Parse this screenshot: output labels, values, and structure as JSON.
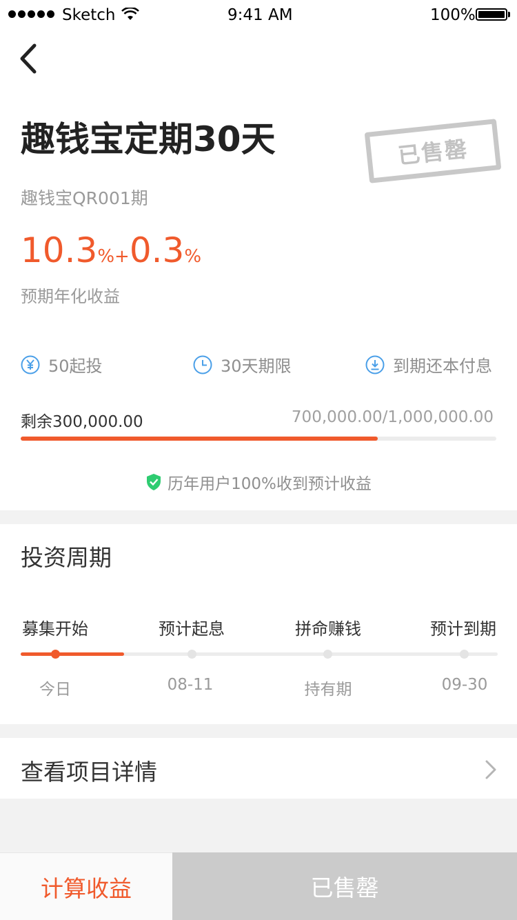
{
  "status_bar": {
    "carrier": "Sketch",
    "time": "9:41 AM",
    "battery": "100%"
  },
  "product": {
    "title": "趣钱宝定期30天",
    "subtitle": "趣钱宝QR001期",
    "stamp": "已售罄",
    "rate": {
      "base": "10.3",
      "base_unit": "%",
      "plus": "+",
      "bonus": "0.3",
      "bonus_unit": "%"
    },
    "rate_label": "预期年化收益"
  },
  "features": [
    {
      "icon": "yen-icon",
      "label": "50起投"
    },
    {
      "icon": "clock-icon",
      "label": "30天期限"
    },
    {
      "icon": "download-icon",
      "label": "到期还本付息"
    }
  ],
  "progress": {
    "remaining_label": "剩余300,000.00",
    "total_label": "700,000.00/1,000,000.00",
    "fraction": 0.75
  },
  "guarantee": "历年用户100%收到预计收益",
  "cycle": {
    "title": "投资周期",
    "stages": [
      {
        "label": "募集开始",
        "date": "今日"
      },
      {
        "label": "预计起息",
        "date": "08-11"
      },
      {
        "label": "拼命赚钱",
        "date": "持有期"
      },
      {
        "label": "预计到期",
        "date": "09-30"
      }
    ]
  },
  "details_label": "查看项目详情",
  "bottom": {
    "calc_label": "计算收益",
    "sold_label": "已售罄"
  },
  "colors": {
    "accent": "#f05a2c",
    "icon_blue": "#4a9fe8",
    "shield_green": "#2ecc71"
  }
}
